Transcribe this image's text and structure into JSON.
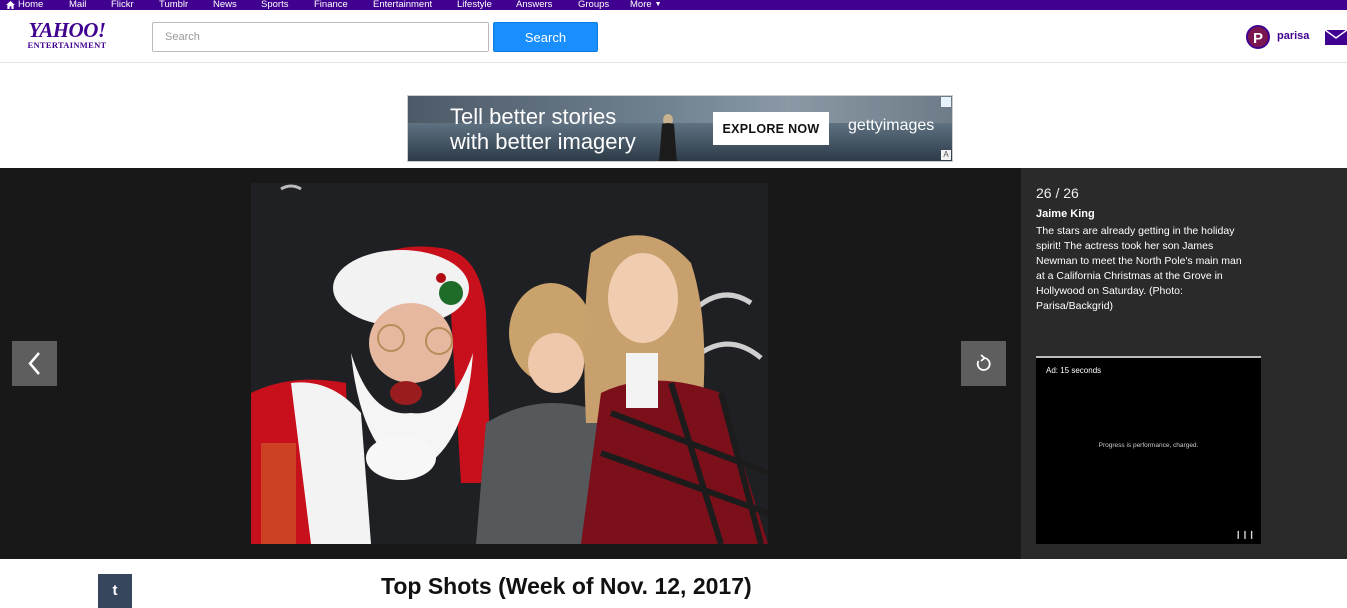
{
  "topnav": {
    "items": [
      "Home",
      "Mail",
      "Flickr",
      "Tumblr",
      "News",
      "Sports",
      "Finance",
      "Entertainment",
      "Lifestyle",
      "Answers",
      "Groups",
      "More"
    ]
  },
  "header": {
    "logo_line1": "YAHOO!",
    "logo_line2": "ENTERTAINMENT",
    "search_placeholder": "Search",
    "search_button": "Search",
    "avatar_letter": "P",
    "username": "parisa"
  },
  "ad": {
    "headline_line1": "Tell better stories",
    "headline_line2": "with better imagery",
    "cta": "EXPLORE NOW",
    "brand": "gettyimages"
  },
  "slideshow": {
    "counter": "26 / 26",
    "caption_title": "Jaime King",
    "caption_body": "The stars are already getting in the holiday spirit! The actress took her son James Newman to meet the North Pole's main man at a California Christmas at the Grove in Hollywood on Saturday. (Photo: Parisa/Backgrid)",
    "video_ad_timer": "Ad: 15 seconds",
    "video_ad_tagline": "Progress is performance, charged."
  },
  "gallery": {
    "title": "Top Shots (Week of Nov. 12, 2017)",
    "tumblr_label": "t"
  },
  "colors": {
    "nav_purple": "#400090",
    "search_blue": "#198fff",
    "slideshow_bg": "#181818",
    "sidebar_bg": "#2a2a2b"
  }
}
